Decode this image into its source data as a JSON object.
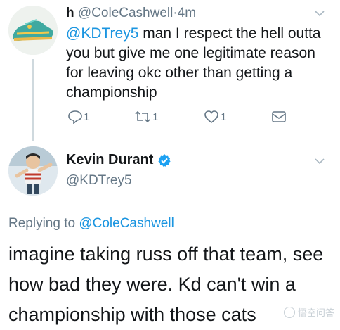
{
  "tweet1": {
    "avatar_icon": "sneaker-avatar-icon",
    "display_name": "h",
    "handle": "@ColeCashwell",
    "time_sep": "·",
    "time": "4m",
    "mention": "@KDTrey5",
    "text": " man I respect the hell outta you but give me one legitimate reason for leaving okc other than getting a championship",
    "reply_count": "1",
    "retweet_count": "1",
    "like_count": "1"
  },
  "tweet2": {
    "avatar_icon": "player-avatar-icon",
    "display_name": "Kevin Durant",
    "handle": "@KDTrey5",
    "replying_prefix": "Replying to ",
    "replying_to": "@ColeCashwell",
    "text": "imagine taking russ off that team, see how bad they were. Kd can't win a championship with those cats"
  },
  "watermark": "悟空问答",
  "colors": {
    "link_blue": "#1b95e0",
    "verified_blue": "#1da1f2",
    "secondary_text": "#657786"
  }
}
